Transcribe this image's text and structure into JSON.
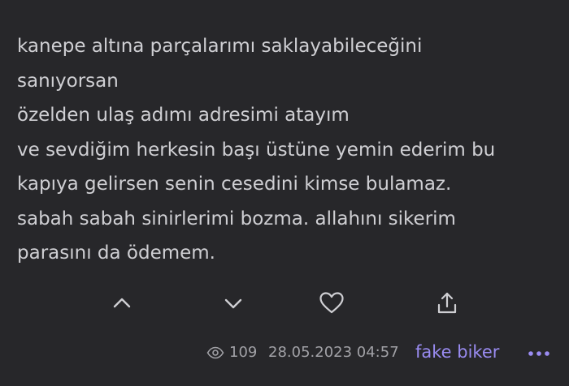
{
  "entry": {
    "lines": [
      "kanepe altına parçalarımı saklayabileceğini",
      "sanıyorsan",
      "özelden ulaş adımı adresimi atayım",
      "ve sevdiğim herkesin başı üstüne yemin ederim bu",
      "kapıya gelirsen senin cesedini kimse bulamaz.",
      "sabah sabah sinirlerimi bozma. allahını sikerim",
      "parasını da ödemem."
    ]
  },
  "actions": {
    "icons": [
      "chevron-up-icon",
      "chevron-down-icon",
      "heart-icon",
      "share-icon"
    ]
  },
  "meta": {
    "views": "109",
    "date": "28.05.2023 04:57",
    "author": "fake biker",
    "more_icon": "more-dots-icon"
  },
  "colors": {
    "background": "#27272a",
    "text": "#cfcfd3",
    "muted": "#a1a1a6",
    "author": "#9a8cf2"
  }
}
